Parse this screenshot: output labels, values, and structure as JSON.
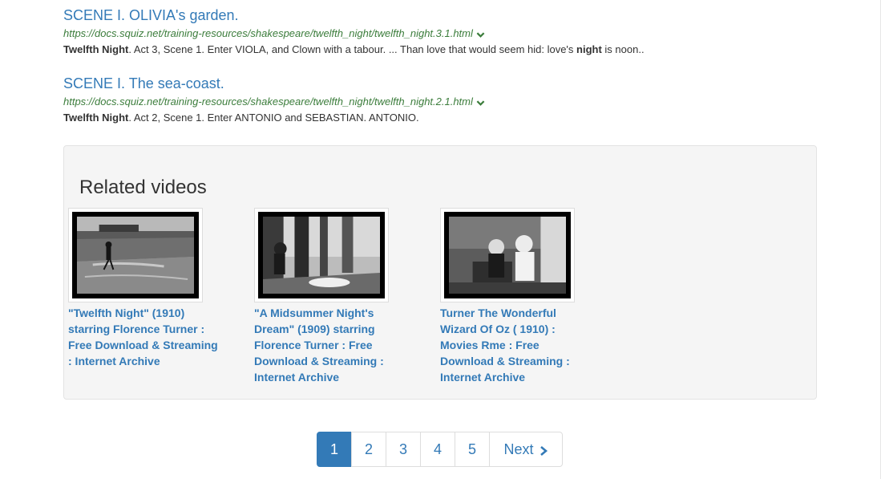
{
  "results": [
    {
      "title": "SCENE I. OLIVIA's garden.",
      "url": "https://docs.squiz.net/training-resources/shakespeare/twelfth_night/twelfth_night.3.1.html",
      "snippet_bold": "Twelfth Night",
      "snippet_mid": ". Act 3, Scene 1. Enter VIOLA, and Clown with a tabour. ... Than love that would seem hid: love's ",
      "snippet_bold2": "night",
      "snippet_end": " is noon.."
    },
    {
      "title": "SCENE I. The sea-coast.",
      "url": "https://docs.squiz.net/training-resources/shakespeare/twelfth_night/twelfth_night.2.1.html",
      "snippet_bold": "Twelfth Night",
      "snippet_mid": ". Act 2, Scene 1. Enter ANTONIO and SEBASTIAN. ANTONIO."
    }
  ],
  "related": {
    "heading": "Related videos",
    "videos": [
      {
        "title": "\"Twelfth Night\" (1910) starring Florence Turner : Free Download & Streaming : Internet Archive",
        "thumb_icon": "beach-scene-thumbnail"
      },
      {
        "title": "\"A Midsummer Night's Dream\" (1909) starring Florence Turner : Free Download & Streaming : Internet Archive",
        "thumb_icon": "forest-scene-thumbnail"
      },
      {
        "title": "Turner The Wonderful Wizard Of Oz ( 1910) : Movies Rme : Free Download & Streaming : Internet Archive",
        "thumb_icon": "stage-scene-thumbnail"
      }
    ]
  },
  "pagination": {
    "pages": [
      "1",
      "2",
      "3",
      "4",
      "5"
    ],
    "active": "1",
    "next_label": "Next"
  },
  "colors": {
    "link": "#337ab7",
    "url_green": "#3c7d3c",
    "panel_bg": "#f5f5f5",
    "active_page_bg": "#337ab7"
  }
}
